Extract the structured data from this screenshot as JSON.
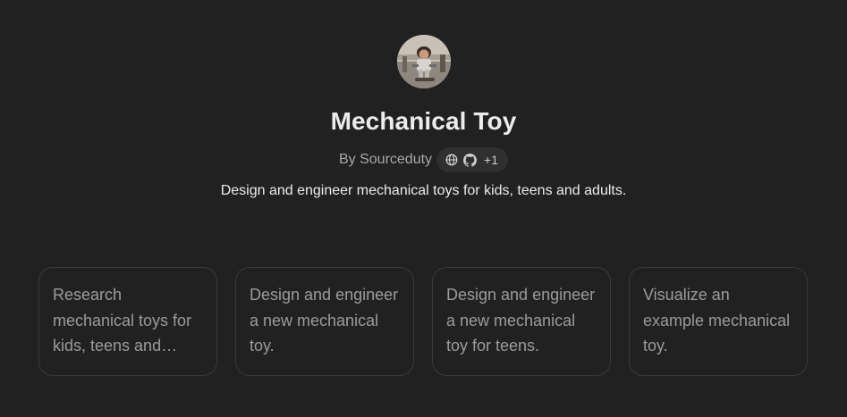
{
  "gpt": {
    "title": "Mechanical Toy",
    "author": "By Sourceduty",
    "links": {
      "icons": [
        "globe-icon",
        "github-icon"
      ],
      "extra_count": "+1"
    },
    "description": "Design and engineer mechanical toys for kids, teens and adults."
  },
  "conversation_starters": [
    "Research mechanical toys for kids, teens and adults.",
    "Design and engineer a new mechanical toy.",
    "Design and engineer a new mechanical toy for teens.",
    "Visualize an example mechanical toy."
  ],
  "colors": {
    "background": "#212121",
    "card_border": "#3a3a3a",
    "pill_background": "#2f2f2f",
    "primary_text": "#ececec",
    "muted_text": "#9b9b9b"
  }
}
